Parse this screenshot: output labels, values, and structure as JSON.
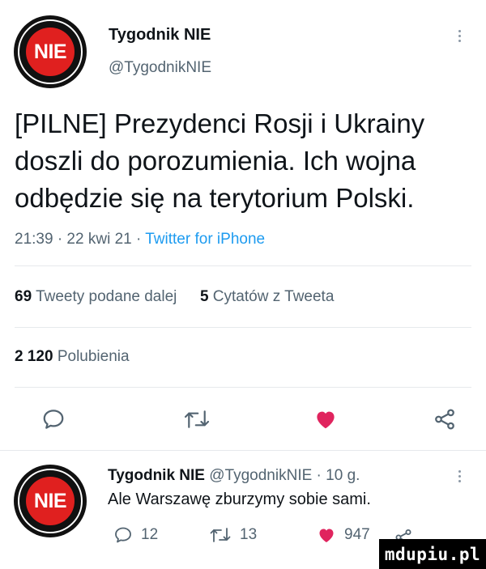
{
  "tweet": {
    "author_name": "Tygodnik NIE",
    "author_handle": "@TygodnikNIE",
    "avatar_text": "NIE",
    "text_lines": [
      "[PILNE] Prezydenci Rosji i Ukrainy",
      "doszli do porozumienia. Ich wojna",
      "odbędzie się na terytorium Polski."
    ],
    "meta_time": "21:39 · 22 kwi 21 · ",
    "meta_source": "Twitter for iPhone",
    "retweets_count": "69",
    "retweets_label": "Tweety podane dalej",
    "quotes_count": "5",
    "quotes_label": "Cytatów z Tweeta",
    "likes_count": "2 120",
    "likes_label": "Polubienia",
    "icons": [
      "reply-icon",
      "retweet-icon",
      "like-icon",
      "share-icon"
    ]
  },
  "reply": {
    "author_name": "Tygodnik NIE",
    "author_handle_time": "@TygodnikNIE · 10 g.",
    "text": "Ale Warszawę zburzymy sobie sami.",
    "reply_count": "12",
    "retweet_count": "13",
    "like_count": "947"
  },
  "watermark": "mdupiu.pl",
  "colors": {
    "accent": "#1d9bf0",
    "like": "#e0245e",
    "brand_red": "#e0201f",
    "muted": "#536471"
  }
}
